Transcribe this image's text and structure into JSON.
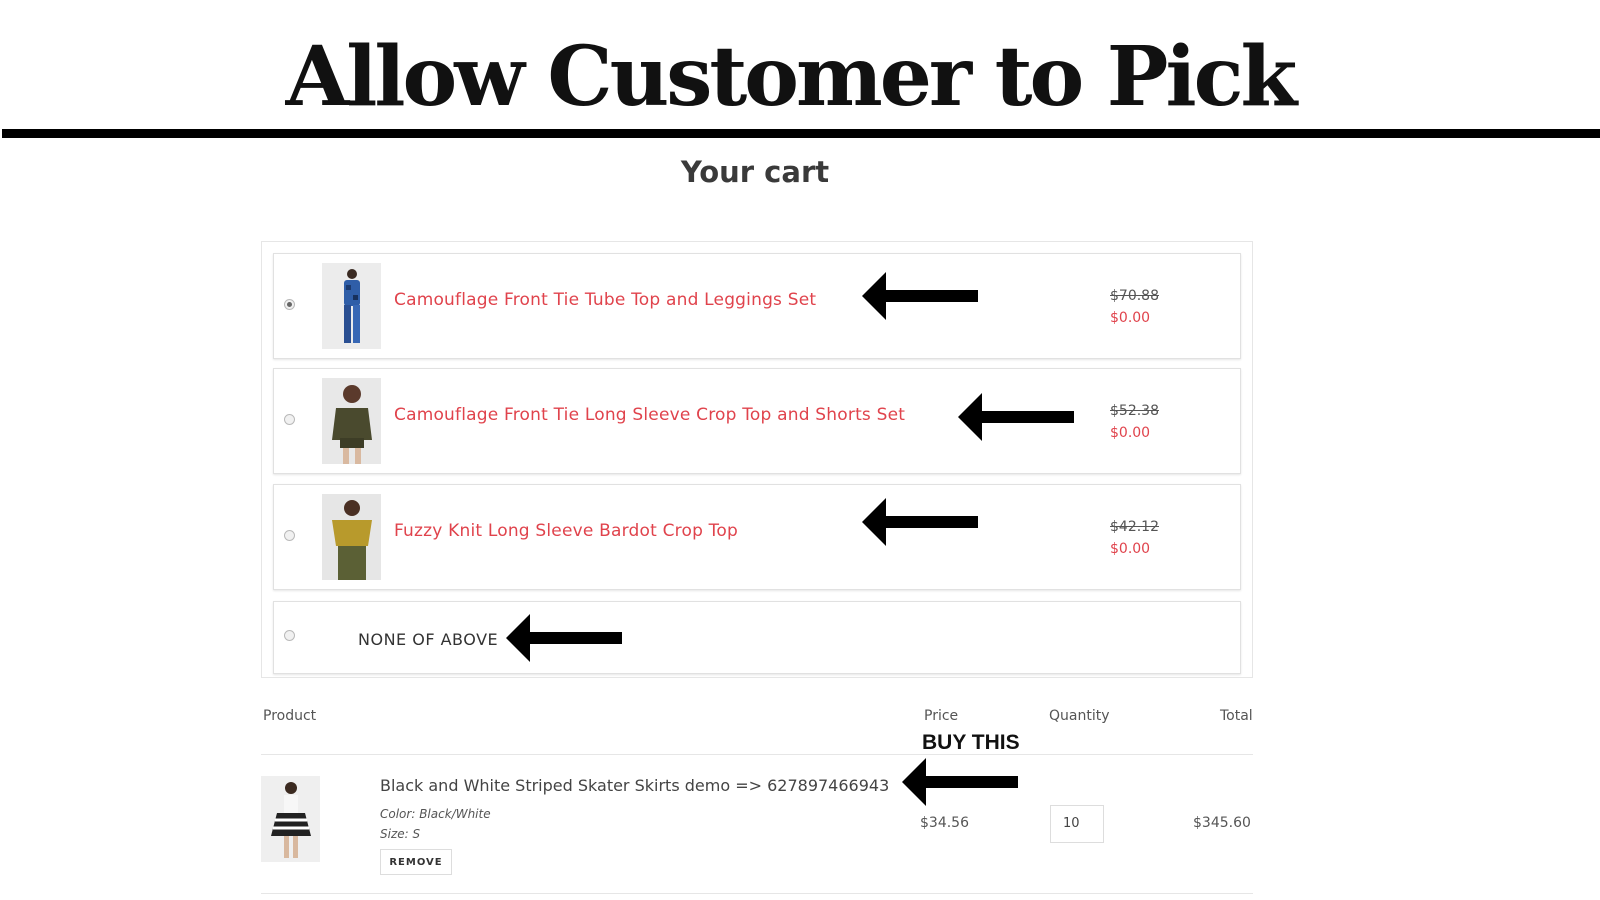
{
  "banner": {
    "title": "Allow Customer to Pick"
  },
  "cart": {
    "title": "Your cart"
  },
  "offers": [
    {
      "name": "Camouflage Front Tie Tube Top and Leggings Set",
      "old_price": "$70.88",
      "new_price": "$0.00",
      "selected": true
    },
    {
      "name": "Camouflage Front Tie Long Sleeve Crop Top and Shorts Set",
      "old_price": "$52.38",
      "new_price": "$0.00",
      "selected": false
    },
    {
      "name": "Fuzzy Knit Long Sleeve Bardot Crop Top",
      "old_price": "$42.12",
      "new_price": "$0.00",
      "selected": false
    }
  ],
  "none_option": {
    "label": "NONE OF ABOVE",
    "selected": false
  },
  "table": {
    "headers": {
      "product": "Product",
      "price": "Price",
      "quantity": "Quantity",
      "total": "Total"
    }
  },
  "annotation": {
    "buy_this": "BUY THIS"
  },
  "line_item": {
    "name": "Black and White Striped Skater Skirts demo => 627897466943",
    "color": "Color: Black/White",
    "size": "Size: S",
    "remove_label": "REMOVE",
    "price": "$34.56",
    "quantity": "10",
    "total": "$345.60"
  },
  "colors": {
    "accent": "#e0434c",
    "arrow": "#000000"
  },
  "icons": {
    "arrow": "left-arrow-icon"
  }
}
